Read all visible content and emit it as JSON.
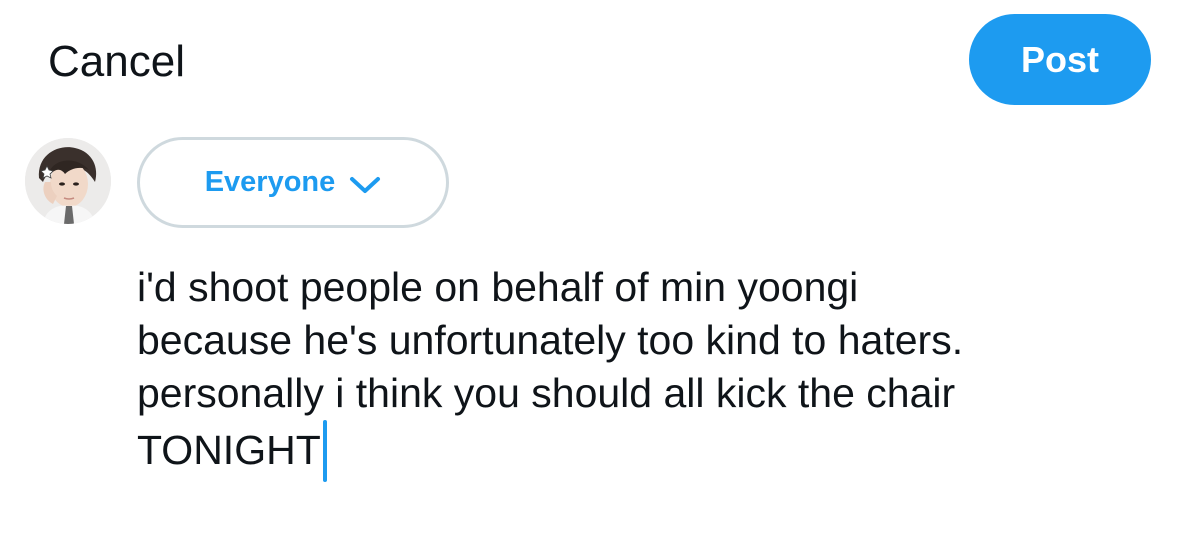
{
  "header": {
    "cancel_label": "Cancel",
    "post_label": "Post"
  },
  "composer": {
    "audience_label": "Everyone",
    "audience_icon": "chevron-down-icon",
    "text_lines": [
      "i'd shoot people on behalf of min yoongi",
      "because he's unfortunately too kind to haters.",
      "personally i think you should all kick the chair",
      "TONIGHT"
    ]
  },
  "colors": {
    "accent": "#1d9bf0",
    "text": "#0f1419",
    "border": "#cfd9de",
    "background": "#ffffff"
  }
}
